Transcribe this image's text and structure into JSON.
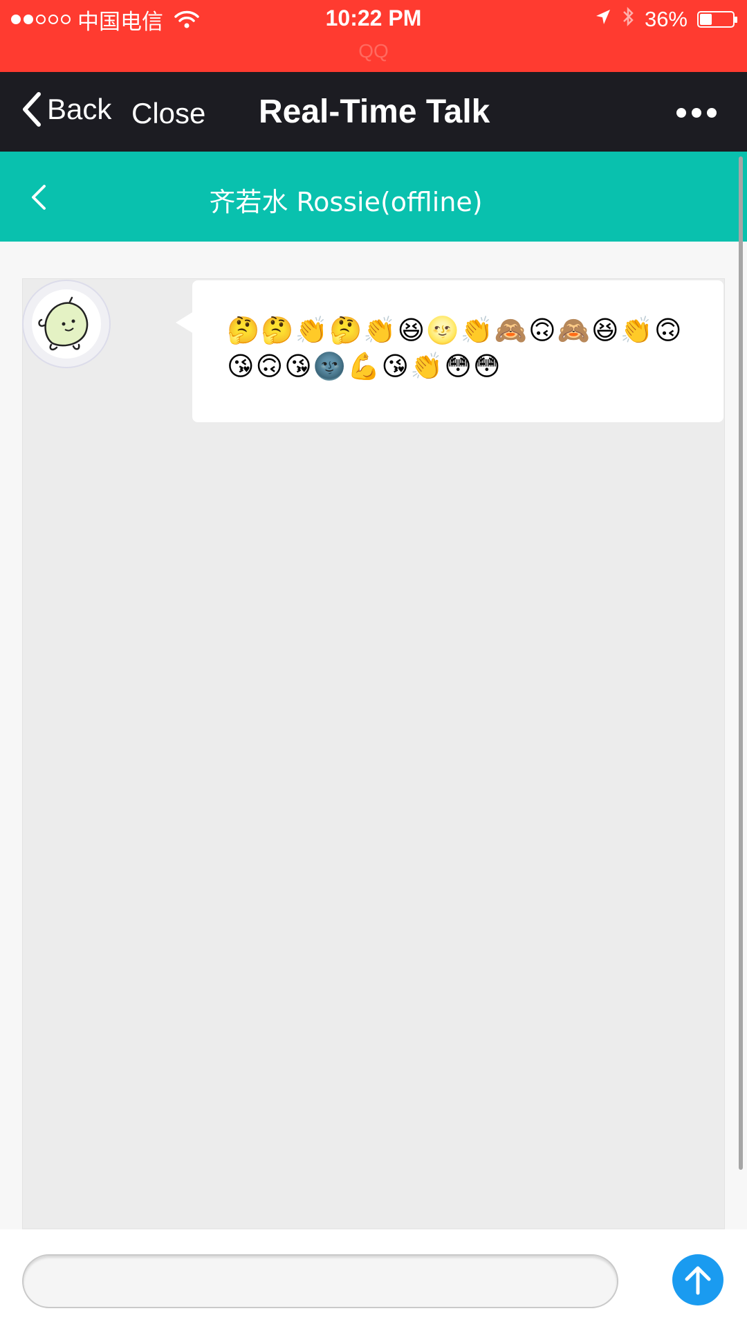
{
  "status_bar": {
    "carrier": "中国电信",
    "time": "10:22 PM",
    "battery_percent": "36%",
    "battery_level": 0.36,
    "app_name": "QQ",
    "background_color": "#ff3b30"
  },
  "nav_bar": {
    "back_label": "Back",
    "close_label": "Close",
    "title": "Real-Time Talk",
    "background_color": "#1c1c22"
  },
  "chat_header": {
    "title": "齐若水 Rossie(offline)",
    "background_color": "#09c1ae"
  },
  "messages": [
    {
      "sender": "Rossie",
      "text": "🤔🤔👏🤔👏😆🌝👏🙈🙃🙈😆👏🙃😘🙃😘🌚💪😘👏😳😳"
    }
  ],
  "input": {
    "value": "",
    "placeholder": ""
  },
  "icons": {
    "send": "arrow-up-icon",
    "more": "more-dots-icon",
    "back": "chevron-left-icon"
  },
  "colors": {
    "send_button": "#1a9bf0",
    "chat_background": "#ececec"
  }
}
